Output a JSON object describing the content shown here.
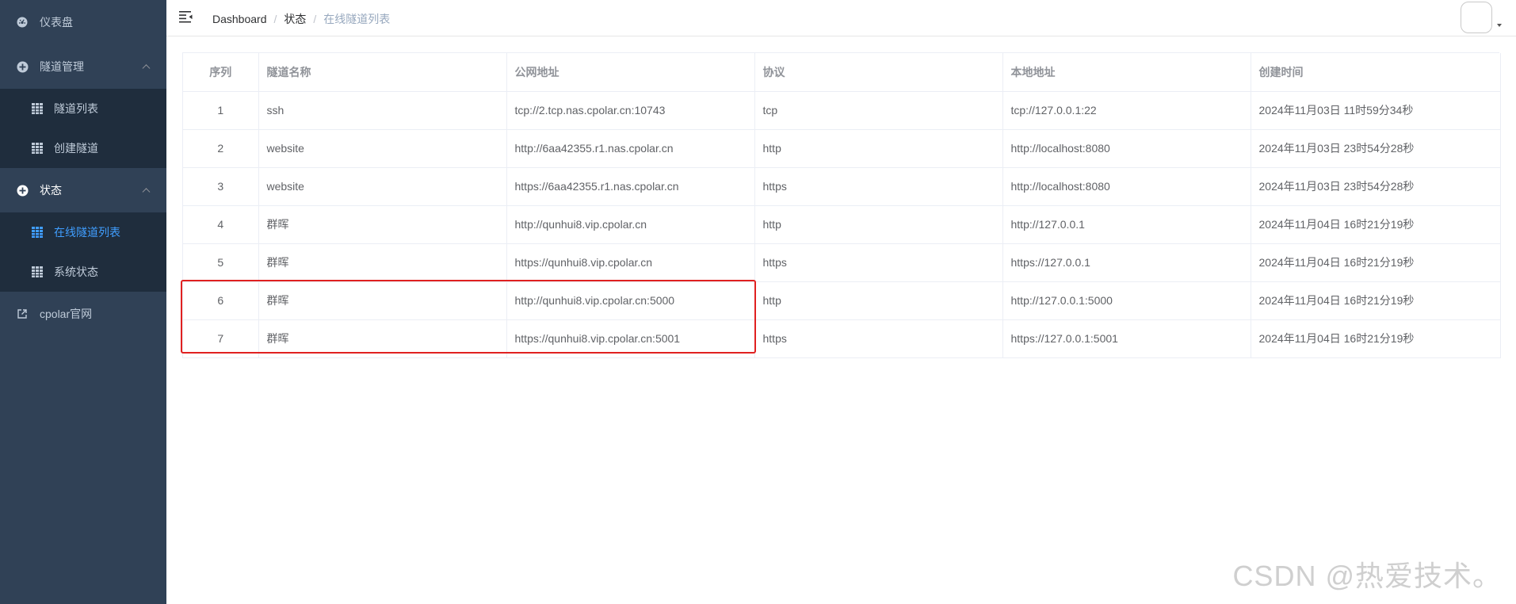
{
  "sidebar": {
    "dashboard": "仪表盘",
    "tunnel_mgmt": "隧道管理",
    "tunnel_list": "隧道列表",
    "create_tunnel": "创建隧道",
    "status": "状态",
    "online_tunnels": "在线隧道列表",
    "system_status": "系统状态",
    "official_site": "cpolar官网"
  },
  "breadcrumb": [
    "Dashboard",
    "状态",
    "在线隧道列表"
  ],
  "table": {
    "headers": [
      "序列",
      "隧道名称",
      "公网地址",
      "协议",
      "本地地址",
      "创建时间"
    ],
    "rows": [
      [
        "1",
        "ssh",
        "tcp://2.tcp.nas.cpolar.cn:10743",
        "tcp",
        "tcp://127.0.0.1:22",
        "2024年11月03日 11时59分34秒"
      ],
      [
        "2",
        "website",
        "http://6aa42355.r1.nas.cpolar.cn",
        "http",
        "http://localhost:8080",
        "2024年11月03日 23时54分28秒"
      ],
      [
        "3",
        "website",
        "https://6aa42355.r1.nas.cpolar.cn",
        "https",
        "http://localhost:8080",
        "2024年11月03日 23时54分28秒"
      ],
      [
        "4",
        "群晖",
        "http://qunhui8.vip.cpolar.cn",
        "http",
        "http://127.0.0.1",
        "2024年11月04日 16时21分19秒"
      ],
      [
        "5",
        "群晖",
        "https://qunhui8.vip.cpolar.cn",
        "https",
        "https://127.0.0.1",
        "2024年11月04日 16时21分19秒"
      ],
      [
        "6",
        "群晖",
        "http://qunhui8.vip.cpolar.cn:5000",
        "http",
        "http://127.0.0.1:5000",
        "2024年11月04日 16时21分19秒"
      ],
      [
        "7",
        "群晖",
        "https://qunhui8.vip.cpolar.cn:5001",
        "https",
        "https://127.0.0.1:5001",
        "2024年11月04日 16时21分19秒"
      ]
    ]
  },
  "watermark": "CSDN @热爱技术。",
  "colors": {
    "sidebar_bg": "#304156",
    "submenu_bg": "#1f2d3d",
    "active": "#409eff",
    "highlight": "#e02020"
  }
}
